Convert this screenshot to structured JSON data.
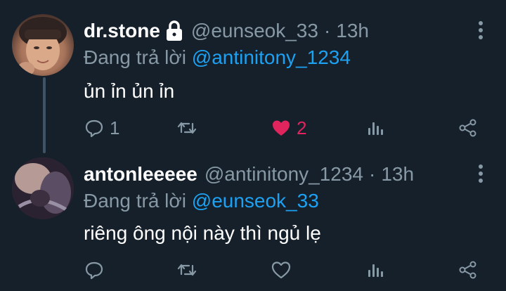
{
  "colors": {
    "background": "#15202b",
    "secondary_text": "#8899a6",
    "mention": "#1da1f2",
    "like_active": "#e0245e",
    "thread_line": "#3d5466"
  },
  "tweets": [
    {
      "display_name": "dr.stone",
      "protected_icon": "lock-icon",
      "handle": "@eunseok_33",
      "separator": "·",
      "time": "13h",
      "reply_prefix": "Đang trả lời",
      "reply_to": "@antinitony_1234",
      "text": "ủn ỉn ủn ỉn",
      "reply_count": "1",
      "retweet_count": "",
      "like_count": "2",
      "liked": true
    },
    {
      "display_name": "antonleeeee",
      "handle": "@antinitony_1234",
      "separator": "·",
      "time": "13h",
      "reply_prefix": "Đang trả lời",
      "reply_to": "@eunseok_33",
      "text": "riêng ông nội này thì ngủ lẹ",
      "reply_count": "",
      "retweet_count": "",
      "like_count": "",
      "liked": false
    }
  ]
}
